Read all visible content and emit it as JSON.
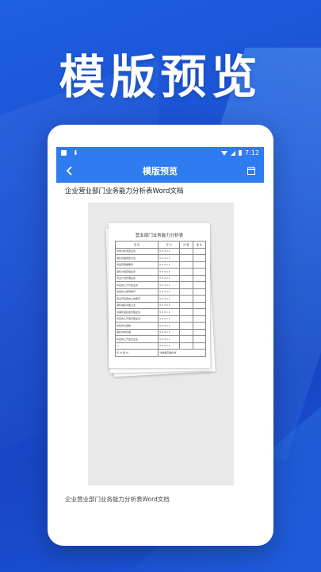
{
  "promo": {
    "title": "模版预览"
  },
  "statusbar": {
    "time": "7:12"
  },
  "appbar": {
    "title": "模版预览"
  },
  "document": {
    "title": "企业营业部门业务能力分析表Word文档",
    "caption": "企业营业部门业务能力分析表Word文档"
  },
  "sheet": {
    "title": "营业部门业务能力分析表",
    "headers": [
      "项  目",
      "评  分",
      "内  容",
      "备  注"
    ],
    "rows": [
      [
        "市场分析调查业务",
        "5 4 3 2 1"
      ],
      [
        "销售管理调查方法",
        "5 4 3 2 1"
      ],
      [
        "商品营销策略导",
        "5 4 3 2 1"
      ],
      [
        "销售价格营销业务",
        "5 4 3 2 1"
      ],
      [
        "营业计划管理业务",
        "5 4 3 2 1"
      ],
      [
        "商店向上与开发业务",
        "5 4 3 2 1"
      ],
      [
        "商店向上指导教育",
        "5 4 3 2 1"
      ],
      [
        "营业开发者向上的教育",
        "5 4 3 2 1"
      ],
      [
        "销售组织对策之业",
        "5 4 3 2 1"
      ],
      [
        "对销售组织的管理业务",
        "5 4 3 2 1"
      ],
      [
        "商店向上开发管理业务",
        "5 4 3 2 1"
      ],
      [
        "零售商力结构",
        "5 4 3 2 1"
      ],
      [
        "销售市场管理",
        "5 4 3 2 1"
      ],
      [
        "商店向上开发表企业",
        "5 4 3 2 1"
      ],
      [
        "(    )",
        "5 4 3 2 1"
      ]
    ],
    "footer": [
      "评 价 得 分",
      "分数越高越优秀"
    ]
  }
}
